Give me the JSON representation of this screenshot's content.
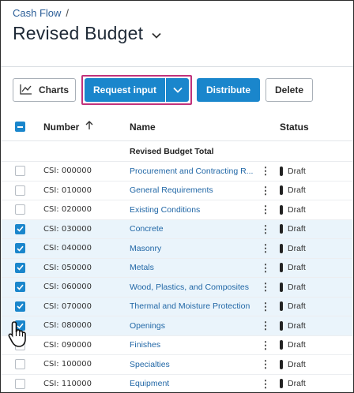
{
  "breadcrumb": {
    "parent": "Cash Flow",
    "separator": "/"
  },
  "header": {
    "title": "Revised Budget"
  },
  "toolbar": {
    "charts_label": "Charts",
    "request_input_label": "Request input",
    "distribute_label": "Distribute",
    "delete_label": "Delete"
  },
  "table": {
    "columns": {
      "number": "Number",
      "name": "Name",
      "status": "Status"
    },
    "total_label": "Revised Budget Total",
    "rows": [
      {
        "number": "CSI: 000000",
        "name": "Procurement and Contracting R...",
        "status": "Draft",
        "checked": false
      },
      {
        "number": "CSI: 010000",
        "name": "General Requirements",
        "status": "Draft",
        "checked": false
      },
      {
        "number": "CSI: 020000",
        "name": "Existing Conditions",
        "status": "Draft",
        "checked": false
      },
      {
        "number": "CSI: 030000",
        "name": "Concrete",
        "status": "Draft",
        "checked": true
      },
      {
        "number": "CSI: 040000",
        "name": "Masonry",
        "status": "Draft",
        "checked": true
      },
      {
        "number": "CSI: 050000",
        "name": "Metals",
        "status": "Draft",
        "checked": true
      },
      {
        "number": "CSI: 060000",
        "name": "Wood, Plastics, and Composites",
        "status": "Draft",
        "checked": true
      },
      {
        "number": "CSI: 070000",
        "name": "Thermal and Moisture Protection",
        "status": "Draft",
        "checked": true
      },
      {
        "number": "CSI: 080000",
        "name": "Openings",
        "status": "Draft",
        "checked": true
      },
      {
        "number": "CSI: 090000",
        "name": "Finishes",
        "status": "Draft",
        "checked": false
      },
      {
        "number": "CSI: 100000",
        "name": "Specialties",
        "status": "Draft",
        "checked": false
      },
      {
        "number": "CSI: 110000",
        "name": "Equipment",
        "status": "Draft",
        "checked": false
      }
    ]
  },
  "colors": {
    "accent": "#1a86cc",
    "link": "#2167a6",
    "highlight": "#c1327b",
    "selected_row": "#eaf4fb"
  },
  "icons": {
    "title_dropdown": "chevron-down-icon",
    "charts": "line-chart-icon",
    "request_dropdown": "chevron-down-icon",
    "sort": "arrow-up-icon",
    "row_menu": "kebab-menu-icon",
    "status": "status-pill-icon",
    "cursor": "hand-pointer-icon"
  }
}
